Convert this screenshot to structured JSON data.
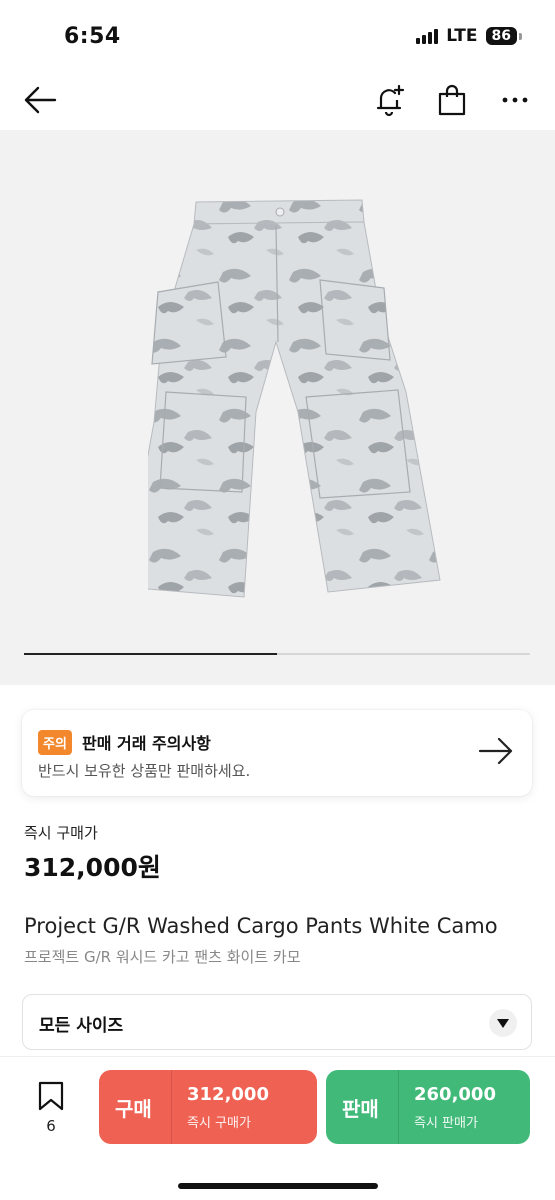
{
  "status_bar": {
    "time": "6:54",
    "network": "LTE",
    "battery": "86"
  },
  "nav": {
    "icons": [
      "back-arrow-icon",
      "bell-plus-icon",
      "shopping-bag-icon",
      "more-horizontal-icon"
    ]
  },
  "gallery": {
    "image_description_icon": "cargo-pants-image",
    "progress": 0.5
  },
  "notice": {
    "badge": "주의",
    "title": "판매 거래 주의사항",
    "subtitle": "반드시 보유한 상품만 판매하세요.",
    "badge_color": "#f3872b"
  },
  "price": {
    "label": "즉시 구매가",
    "value": "312,000원"
  },
  "product": {
    "name": "Project G/R Washed Cargo Pants White Camo",
    "name_ko": "프로젝트 G/R 워시드 카고 팬츠 화이트 카모"
  },
  "size_select": {
    "selected": "모든 사이즈"
  },
  "bottom_bar": {
    "wish_count": "6",
    "buy": {
      "label": "구매",
      "price": "312,000",
      "sub": "즉시 구매가",
      "color": "#ef6253"
    },
    "sell": {
      "label": "판매",
      "price": "260,000",
      "sub": "즉시 판매가",
      "color": "#41b979"
    }
  }
}
